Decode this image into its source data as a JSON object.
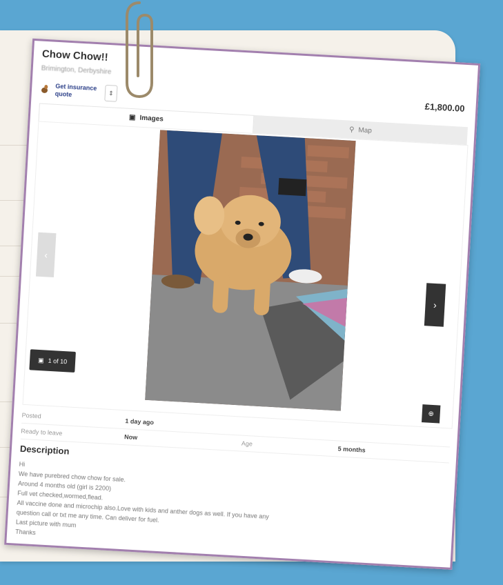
{
  "listing": {
    "title": "Chow Chow!!",
    "location": "Brimington, Derbyshire",
    "insurance_link": "Get insurance quote",
    "price": "£1,800.00"
  },
  "tabs": [
    {
      "label": "Images",
      "icon": "camera-icon",
      "active": true
    },
    {
      "label": "Map",
      "icon": "map-pin-icon",
      "active": false
    }
  ],
  "gallery": {
    "counter": "1 of 10"
  },
  "details": {
    "posted_label": "Posted",
    "posted_value": "1 day ago",
    "ready_label": "Ready to leave",
    "ready_value": "Now",
    "age_label": "Age",
    "age_value": "5 months"
  },
  "description": {
    "heading": "Description",
    "lines": [
      "Hi",
      "We have purebred chow chow for sale.",
      "Around 4 months old (girl is 2200)",
      "Full vet checked,wormed,flead.",
      "All vaccine done and microchip also.Love with kids and anther dogs as well. If you have any",
      "question call or txt me any time. Can deliver for fuel.",
      "Last picture with mum",
      "Thanks"
    ]
  },
  "background": {
    "letter": "a"
  }
}
